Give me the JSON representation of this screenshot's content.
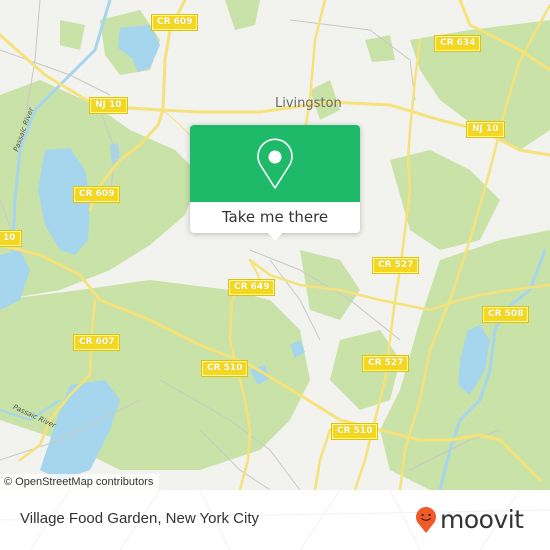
{
  "map": {
    "place_label": "Livingston",
    "river_labels": [
      "Passaic River",
      "Passaic River"
    ],
    "road_shields": [
      {
        "id": "cr609-top",
        "label": "CR 609"
      },
      {
        "id": "nj10-left",
        "label": "NJ 10"
      },
      {
        "id": "cr609-mid",
        "label": "CR 609"
      },
      {
        "id": "nj10-edge",
        "label": "10"
      },
      {
        "id": "cr634",
        "label": "CR 634"
      },
      {
        "id": "nj10-right",
        "label": "NJ 10"
      },
      {
        "id": "cr649",
        "label": "CR 649"
      },
      {
        "id": "cr527-top",
        "label": "CR 527"
      },
      {
        "id": "cr508",
        "label": "CR 508"
      },
      {
        "id": "cr607",
        "label": "CR 607"
      },
      {
        "id": "cr510-mid",
        "label": "CR 510"
      },
      {
        "id": "cr527-bottom",
        "label": "CR 527"
      },
      {
        "id": "cr510-bottom",
        "label": "CR 510"
      }
    ],
    "attribution": "© OpenStreetMap contributors",
    "colors": {
      "land": "#f2f2ee",
      "park": "#c8e2a8",
      "water": "#a6d5ee",
      "road": "#f7e27a",
      "shield": "#f4d81f"
    }
  },
  "popup": {
    "icon": "map-pin-icon",
    "button_label": "Take me there",
    "color": "#1fb96a"
  },
  "footer": {
    "title": "Village Food Garden, New York City",
    "brand": "moovit",
    "brand_icon": "moovit-smiley-pin-icon",
    "brand_color": "#f05a28"
  }
}
